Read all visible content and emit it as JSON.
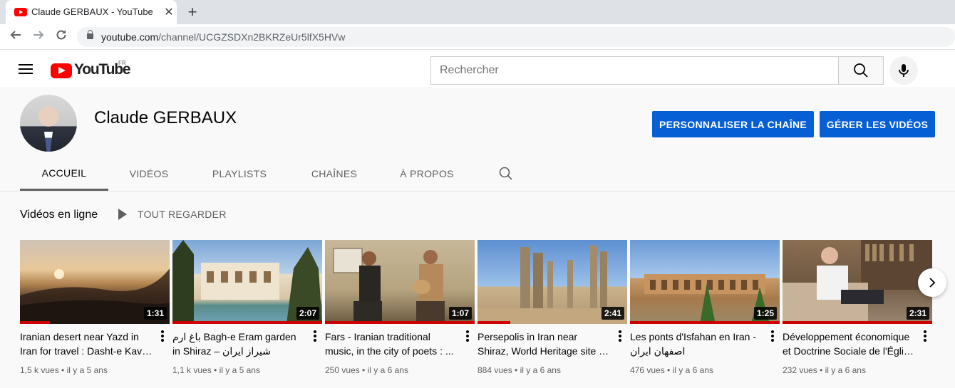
{
  "browser": {
    "tab_title": "Claude GERBAUX - YouTube",
    "tab_close": "✕",
    "new_tab": "+",
    "url_host": "youtube.com",
    "url_path": "/channel/UCGZSDXn2BKRZeUr5lfX5HVw"
  },
  "header": {
    "logo_text": "YouTube",
    "country_code": "FR",
    "search_placeholder": "Rechercher"
  },
  "channel": {
    "name": "Claude GERBAUX",
    "customize_button": "PERSONNALISER LA CHAÎNE",
    "manage_button": "GÉRER LES VIDÉOS",
    "tabs": [
      "ACCUEIL",
      "VIDÉOS",
      "PLAYLISTS",
      "CHAÎNES",
      "À PROPOS"
    ],
    "active_tab": "ACCUEIL"
  },
  "section": {
    "title": "Vidéos en ligne",
    "play_all": "TOUT REGARDER"
  },
  "videos": [
    {
      "title": "Iranian desert near Yazd in Iran for travel : Dasht-e Kavir ...",
      "duration": "1:31",
      "views": "1,5 k vues",
      "age": "il y a 5 ans"
    },
    {
      "title": "باغ ارم Bagh-e Eram garden in Shiraz – شیراز ایران",
      "duration": "2:07",
      "views": "1,1 k vues",
      "age": "il y a 5 ans"
    },
    {
      "title": "Fars - Iranian traditional music, in the city of poets : ...",
      "duration": "1:07",
      "views": "250 vues",
      "age": "il y a 6 ans"
    },
    {
      "title": "Persepolis in Iran near Shiraz, World Heritage site of ...",
      "duration": "2:41",
      "views": "884 vues",
      "age": "il y a 6 ans"
    },
    {
      "title": "Les ponts d'Isfahan en Iran - اصفهان ایران",
      "duration": "1:25",
      "views": "476 vues",
      "age": "il y a 6 ans"
    },
    {
      "title": "Développement économique et Doctrine Sociale de l'Église ...",
      "duration": "2:31",
      "views": "232 vues",
      "age": "il y a 6 ans"
    }
  ],
  "meta_separator": " • ",
  "colors": {
    "accent_blue": "#065fd4",
    "youtube_red": "#ff0000",
    "progress_red": "#cc0000"
  }
}
